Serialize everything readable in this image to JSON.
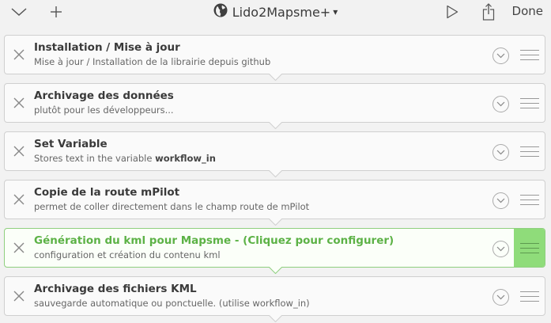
{
  "toolbar": {
    "collapse_icon": "chevron-down-icon",
    "add_icon": "plus-icon",
    "globe_icon": "globe-icon",
    "workflow_title": "Lido2Mapsme+",
    "title_caret": "▾",
    "run_icon": "play-icon",
    "share_icon": "share-icon",
    "done_label": "Done"
  },
  "actions": [
    {
      "title": "Installation / Mise à jour",
      "description": "Mise à jour / Installation de la librairie depuis github",
      "selected": false
    },
    {
      "title": "Archivage des données",
      "description": "plutôt pour les développeurs...",
      "selected": false
    },
    {
      "title": "Set Variable",
      "description_prefix": "Stores text in the variable ",
      "description_variable": "workflow_in",
      "selected": false
    },
    {
      "title": "Copie de la route mPilot",
      "description": "permet de coller directement dans le champ route de mPilot",
      "selected": false
    },
    {
      "title": "Génération du kml pour Mapsme - (Cliquez pour configurer)",
      "description": "configuration et création du contenu kml",
      "selected": true
    },
    {
      "title": "Archivage des fichiers KML",
      "description": "sauvegarde automatique ou ponctuelle. (utilise workflow_in)",
      "selected": false
    }
  ],
  "colors": {
    "background": "#f2f2f2",
    "card": "#fafafa",
    "selected_accent": "#5cb246",
    "selected_handle": "#8fdc7a"
  }
}
